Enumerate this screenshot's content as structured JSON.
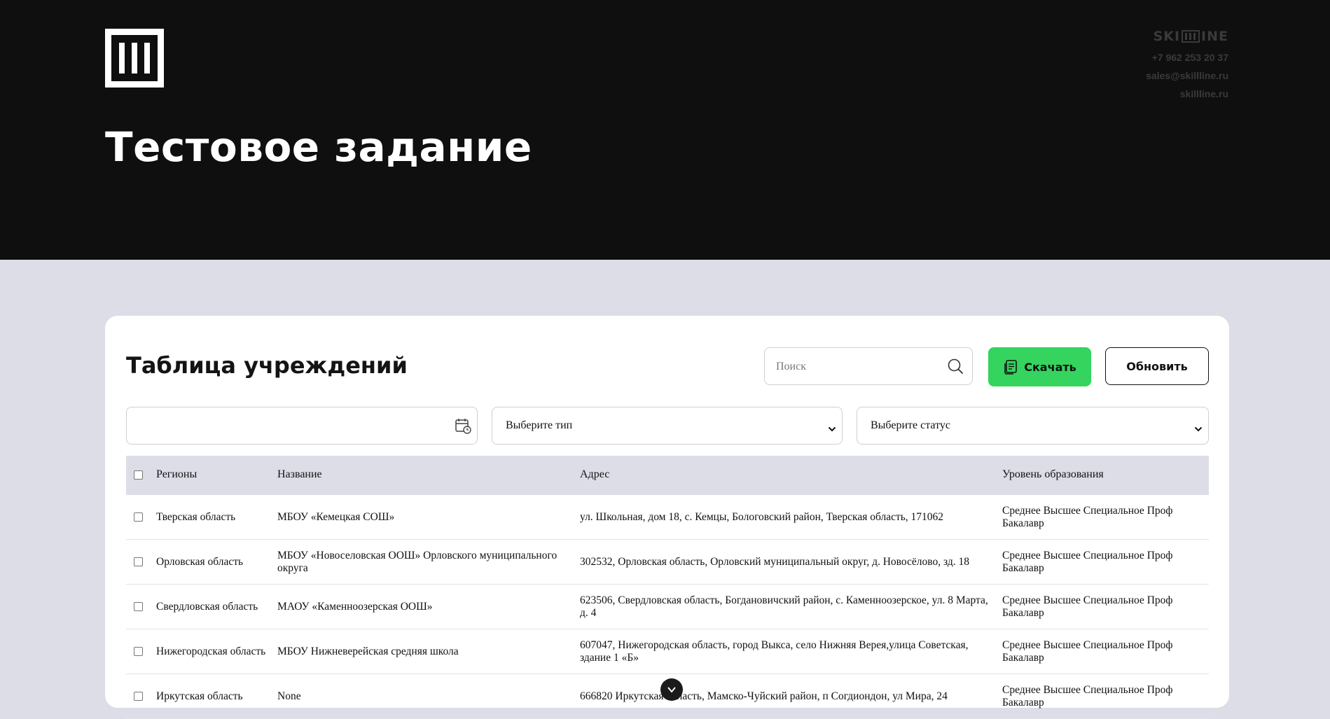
{
  "header": {
    "title": "Тестовое задание",
    "brand_left": "SKI",
    "brand_right": "INE",
    "phone": "+7 962 253 20 37",
    "email": "sales@skillline.ru",
    "site": "skillline.ru"
  },
  "card": {
    "title": "Таблица учреждений",
    "search_placeholder": "Поиск",
    "download_label": "Скачать",
    "refresh_label": "Обновить",
    "date_value": "",
    "type_select": "Выберите тип",
    "status_select": "Выберите статус"
  },
  "table": {
    "headers": {
      "region": "Регионы",
      "name": "Название",
      "address": "Адрес",
      "level": "Уровень образования"
    },
    "rows": [
      {
        "region": "Тверская область",
        "name": "МБОУ «Кемецкая СОШ»",
        "address": "ул. Школьная, дом 18, с. Кемцы, Бологовский район, Тверская область, 171062",
        "level": "Среднее Высшее Специальное Проф Бакалавр"
      },
      {
        "region": "Орловская область",
        "name": "МБОУ «Новоселовская ООШ» Орловского муниципального округа",
        "address": "302532, Орловская область, Орловский муниципальный округ, д. Новосёлово, зд. 18",
        "level": "Среднее Высшее Специальное Проф Бакалавр"
      },
      {
        "region": "Свердловская область",
        "name": "МАОУ «Каменноозерская ООШ»",
        "address": "623506, Свердловская область, Богдановичский район, с. Каменноозерское, ул. 8 Марта, д. 4",
        "level": "Среднее Высшее Специальное Проф Бакалавр"
      },
      {
        "region": "Нижегородская область",
        "name": "МБОУ Нижневерейская средняя школа",
        "address": "607047, Нижегородская область, город Выкса, село Нижняя Верея,улица Советская, здание 1 «Б»",
        "level": "Среднее Высшее Специальное Проф Бакалавр"
      },
      {
        "region": "Иркутская область",
        "name": "None",
        "address": "666820 Иркутская область, Мамско-Чуйский район, п Согдиондон, ул Мира, 24",
        "level": "Среднее Высшее Специальное Проф Бакалавр"
      }
    ]
  },
  "colors": {
    "header_bg": "#0f0f10",
    "page_bg": "#dddde8",
    "accent_green": "#34d45e"
  }
}
